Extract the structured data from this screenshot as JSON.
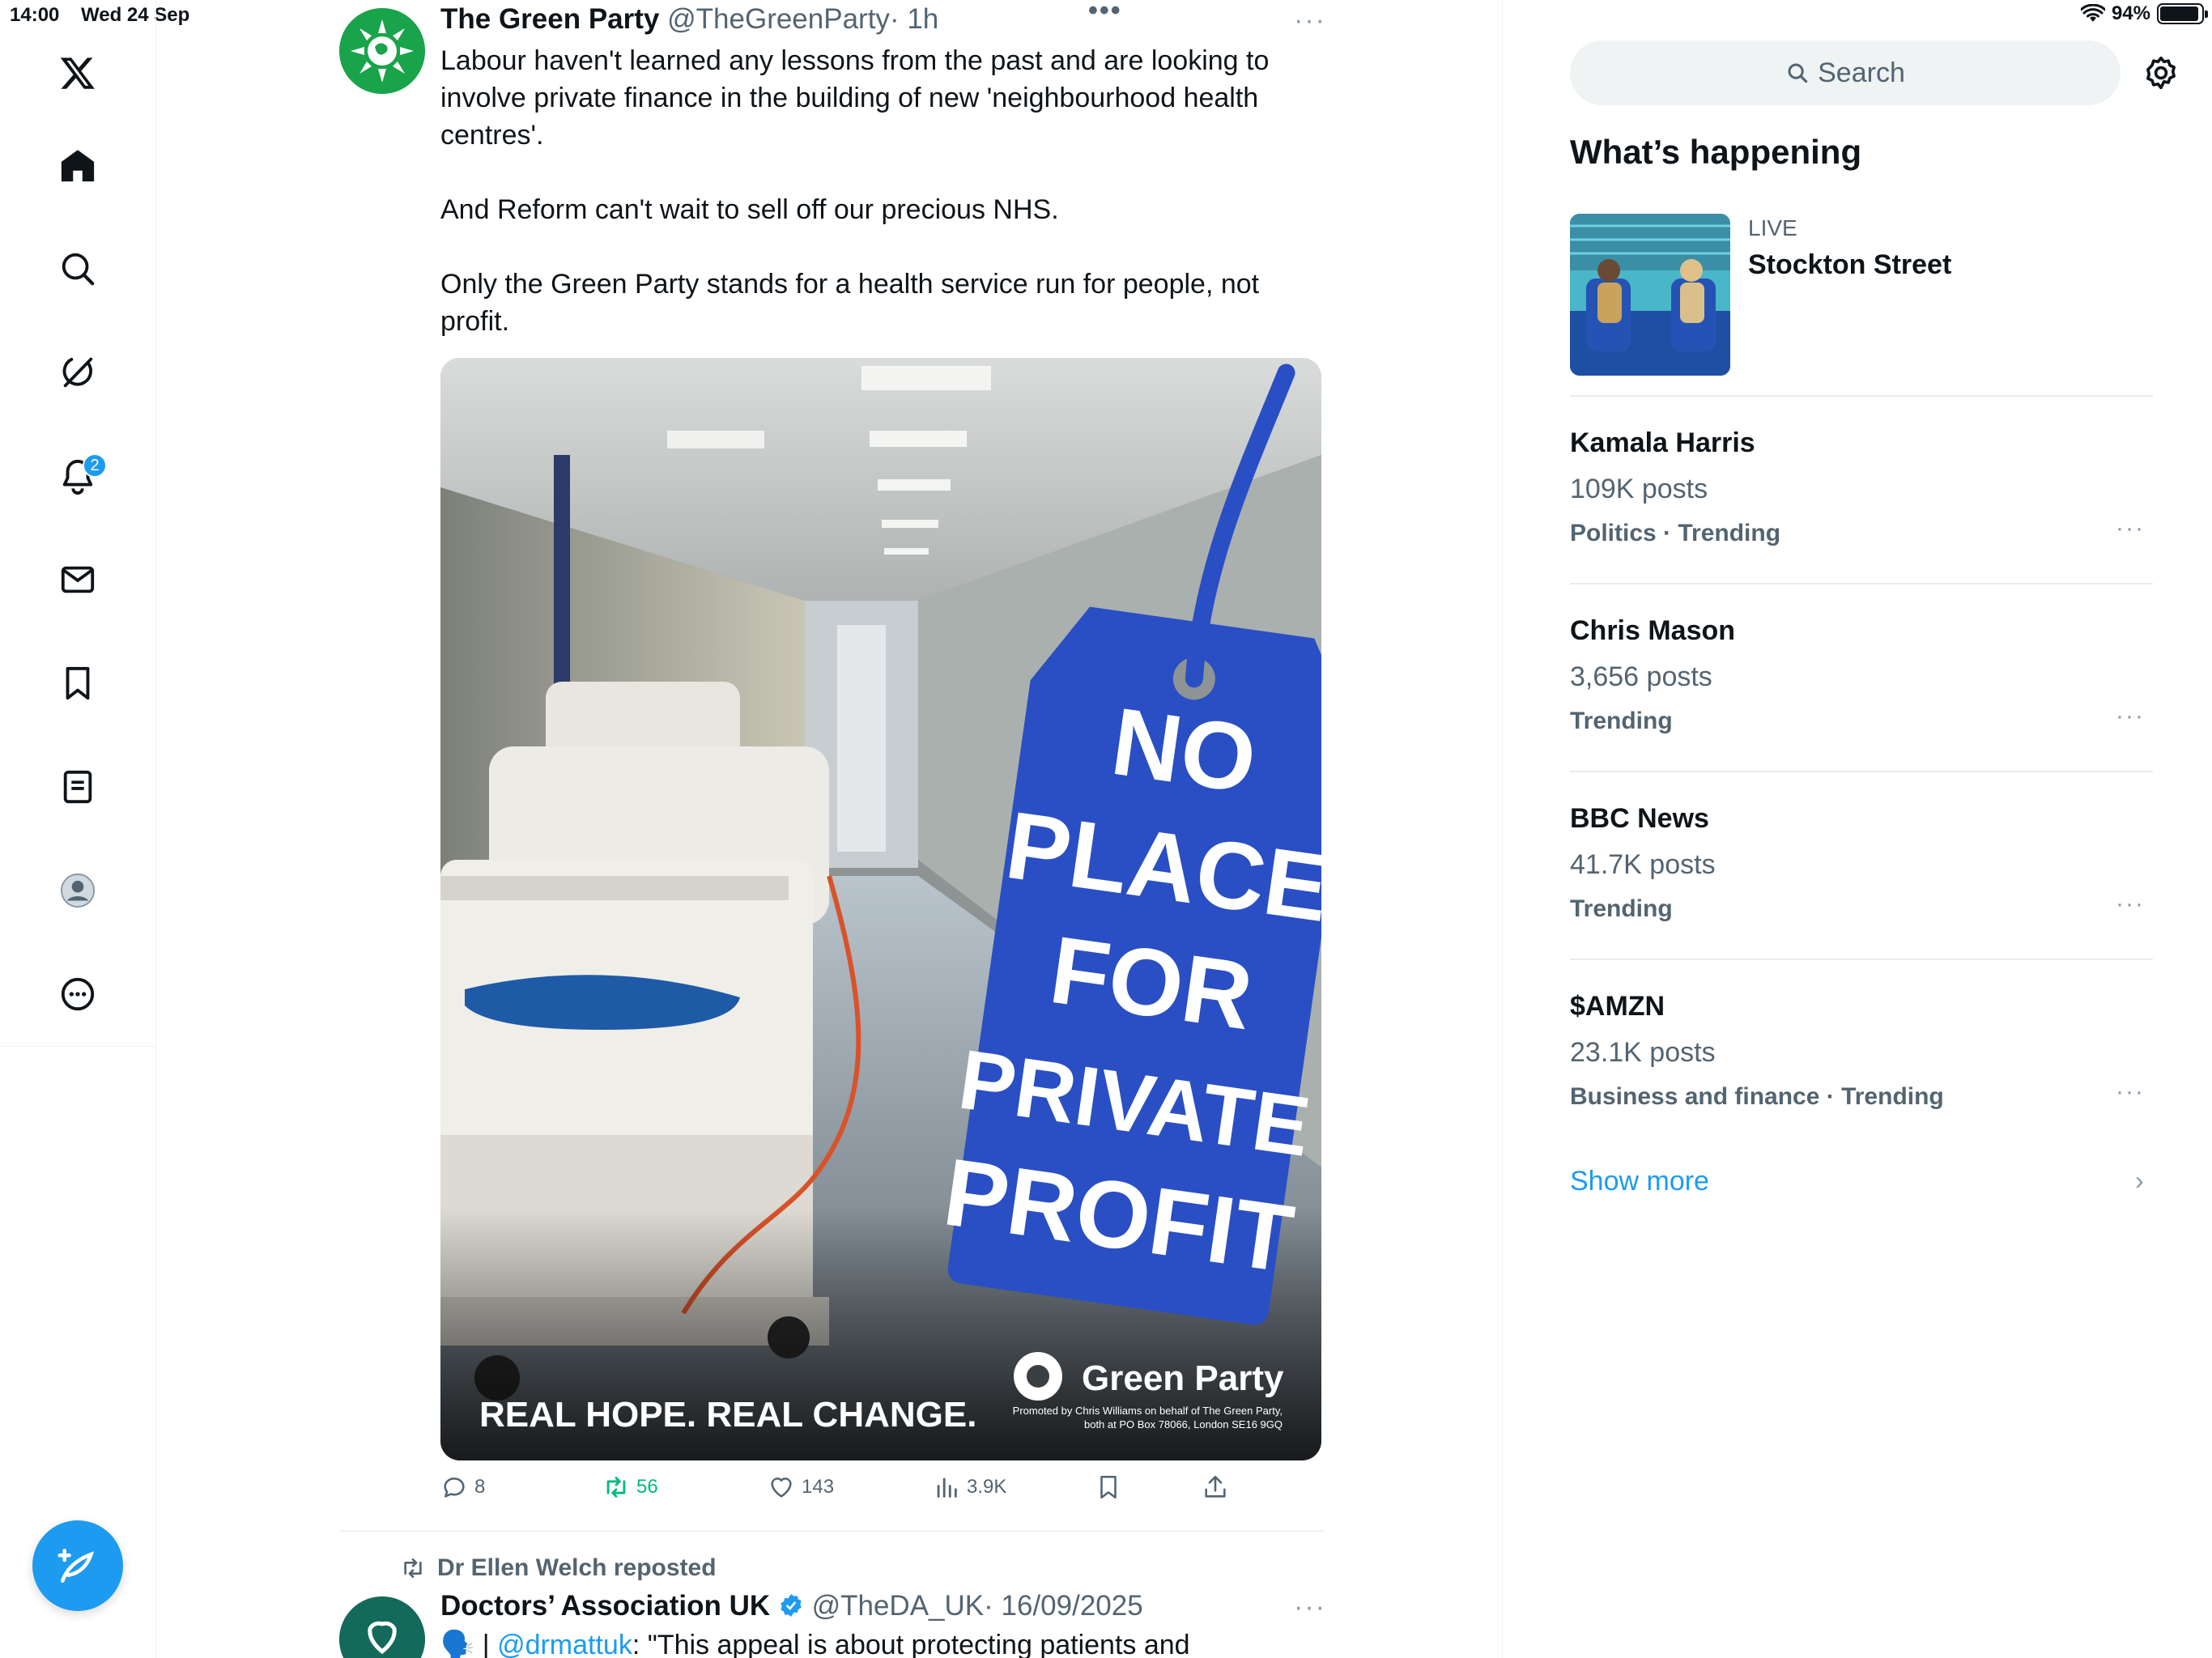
{
  "status_bar": {
    "time": "14:00",
    "date": "Wed 24 Sep",
    "battery": "94%",
    "battery_level": 0.94
  },
  "nav": {
    "notifications_badge": "2",
    "icons": [
      "x-logo-icon",
      "home-icon",
      "search-icon",
      "grok-icon",
      "bell-icon",
      "mail-icon",
      "bookmark-icon",
      "lists-icon",
      "profile-icon",
      "more-icon"
    ]
  },
  "tweet1": {
    "name": "The Green Party",
    "handle": "@TheGreenParty",
    "time": "· 1h",
    "paragraphs": [
      "Labour haven't learned any lessons from the past and are looking to",
      "involve private finance in the building of new 'neighbourhood health",
      "centres'.",
      "",
      "And Reform can't wait to sell off our precious NHS.",
      "",
      "Only the Green Party stands for a health service run for people, not",
      "profit."
    ],
    "poster": {
      "tag_lines": [
        "NO",
        "PLACE",
        "FOR",
        "PRIVATE",
        "PROFIT"
      ],
      "slogan": "REAL HOPE. REAL CHANGE.",
      "brand": "Green Party",
      "imprint_1": "Promoted by Chris Williams on behalf of The Green Party,",
      "imprint_2": "both at PO Box 78066, London SE16 9GQ"
    },
    "actions": {
      "replies": "8",
      "reposts": "56",
      "likes": "143",
      "views": "3.9K"
    }
  },
  "tweet2": {
    "repost_label": "Dr Ellen Welch reposted",
    "name": "Doctors’ Association UK",
    "handle": "@TheDA_UK",
    "time": "· 16/09/2025",
    "text_prefix": "🗣️ | ",
    "mention": "@drmattuk",
    "text_rest": ": \"This appeal is about protecting patients and"
  },
  "sidebar": {
    "search_placeholder": "Search",
    "section_title": "What’s happening",
    "live": {
      "label": "LIVE",
      "title": "Stockton Street"
    },
    "trends": [
      {
        "name": "Kamala Harris",
        "posts": "109K posts",
        "category": "Politics · Trending"
      },
      {
        "name": "Chris Mason",
        "posts": "3,656 posts",
        "category": "Trending"
      },
      {
        "name": "BBC News",
        "posts": "41.7K posts",
        "category": "Trending"
      },
      {
        "name": "$AMZN",
        "posts": "23.1K posts",
        "category": "Business and finance · Trending"
      }
    ],
    "show_more": "Show more"
  },
  "colors": {
    "accent": "#1d9bf0",
    "text": "#0f1419",
    "secondary": "#536471",
    "green_party": "#19a34a",
    "repost_green": "#00ba7c",
    "tag_blue": "#2a4fc4"
  }
}
